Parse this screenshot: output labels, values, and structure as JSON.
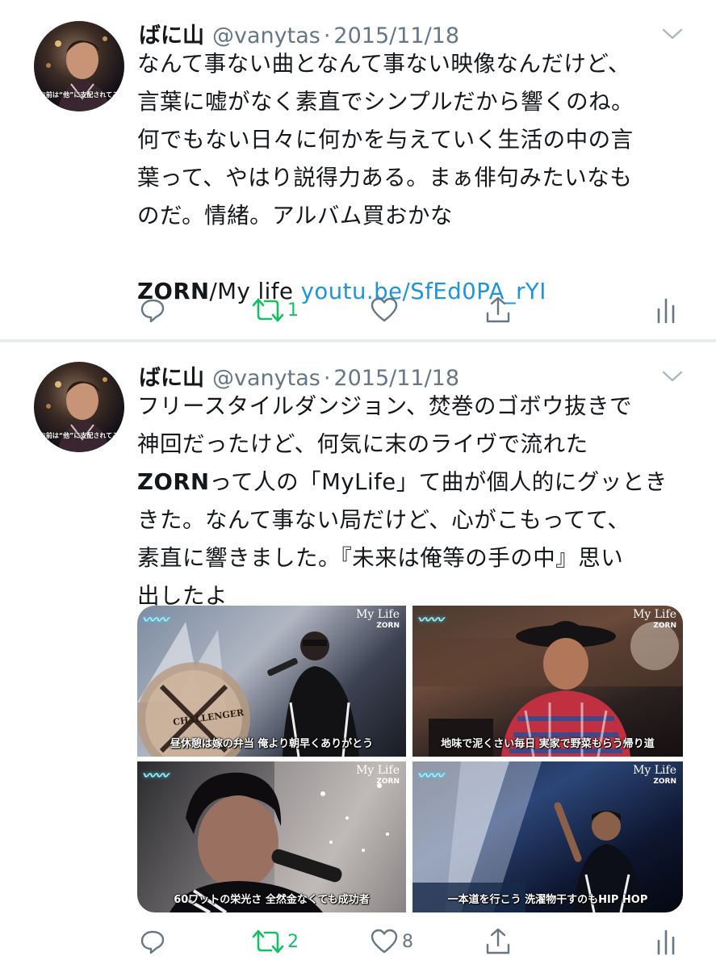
{
  "tweets": [
    {
      "name": "ばに山",
      "handle": "@vanytas",
      "separator": "·",
      "date": "2015/11/18",
      "avatar_caption": "お前は“他”に支配されてる",
      "lines": [
        "なんて事ない曲となんて事ない映像なんだけど、",
        "言葉に嘘がなく素直でシンプルだから響くのね。",
        "何でもない日々に何かを与えていく生活の中の言",
        "葉って、やはり説得力ある。まぁ俳句みたいなも",
        "のだ。情緒。アルバム買おかな"
      ],
      "link_line": {
        "bold": "ZORN",
        "rest": "/My life ",
        "link": "youtu.be/SfEd0PA_rYI"
      },
      "actions": {
        "reply": "",
        "retweet": "1",
        "like": "",
        "share": "",
        "analytics": ""
      }
    },
    {
      "name": "ばに山",
      "handle": "@vanytas",
      "separator": "·",
      "date": "2015/11/18",
      "avatar_caption": "お前は“他”に支配されてる",
      "lines": [
        "フリースタイルダンジョン、焚巻のゴボウ抜きで",
        "神回だったけど、何気に末のライヴで流れた",
        {
          "bold": "ZORN",
          "rest": "って人の「MyLife」て曲が個人的にグッとき"
        },
        "きた。なんて事ない局だけど、心がこもってて、",
        "素直に響きました。『未来は俺等の手の中』思い",
        "出したよ"
      ],
      "media": [
        {
          "caption": "昼休憩は嫁の弁当 俺より朝早くありがとう",
          "song": "My Life",
          "artist": "ZORN",
          "sign": "CHALLENGER"
        },
        {
          "caption": "地味で泥くさい毎日 実家で野菜もらう帰り道",
          "song": "My Life",
          "artist": "ZORN"
        },
        {
          "caption": "60ワットの栄光さ 全然金なくても成功者",
          "song": "My Life",
          "artist": "ZORN"
        },
        {
          "caption": "一本道を行こう 洗濯物干すのもHIP HOP",
          "song": "My Life",
          "artist": "ZORN"
        }
      ],
      "actions": {
        "reply": "",
        "retweet": "2",
        "like": "8",
        "share": "",
        "analytics": ""
      }
    }
  ],
  "colors": {
    "text": "#14171a",
    "secondary": "#657786",
    "link": "#1b95e0",
    "retweet_green": "#17bf63",
    "divider": "#e9ecef"
  }
}
